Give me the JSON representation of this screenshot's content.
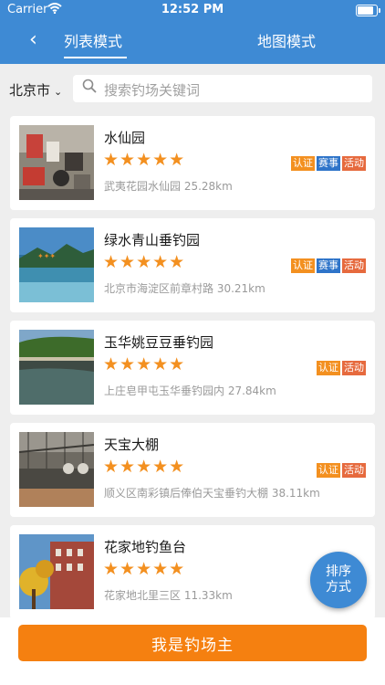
{
  "status_bar": {
    "carrier": "Carrier",
    "time": "12:52 PM"
  },
  "nav": {
    "tab_list": "列表模式",
    "tab_map": "地图模式"
  },
  "search": {
    "city": "北京市",
    "placeholder": "搜索钓场关键词"
  },
  "spots": [
    {
      "name": "水仙园",
      "rating": 5,
      "stars": "★★★★★",
      "address": "武夷花园水仙园 25.28km",
      "tags": [
        "认证",
        "赛事",
        "活动"
      ]
    },
    {
      "name": "绿水青山垂钓园",
      "rating": 5,
      "stars": "★★★★★",
      "address": "北京市海淀区前章村路 30.21km",
      "tags": [
        "认证",
        "赛事",
        "活动"
      ]
    },
    {
      "name": "玉华姚豆豆垂钓园",
      "rating": 5,
      "stars": "★★★★★",
      "address": "上庄皂甲屯玉华垂钓园内 27.84km",
      "tags": [
        "认证",
        "活动"
      ]
    },
    {
      "name": "天宝大棚",
      "rating": 5,
      "stars": "★★★★★",
      "address": "顺义区南彩镇后俸伯天宝垂钓大棚 38.11km",
      "tags": [
        "认证",
        "活动"
      ]
    },
    {
      "name": "花家地钓鱼台",
      "rating": 5,
      "stars": "★★★★★",
      "address": "花家地北里三区 11.33km",
      "tags": []
    }
  ],
  "fab": {
    "line1": "排序",
    "line2": "方式"
  },
  "bottom": {
    "owner_button": "我是钓场主"
  },
  "colors": {
    "primary": "#3e8ad4",
    "accent": "#f58010",
    "tag_certified": "#f39020",
    "tag_event": "#2e74c9",
    "tag_activity": "#e66a3e"
  }
}
